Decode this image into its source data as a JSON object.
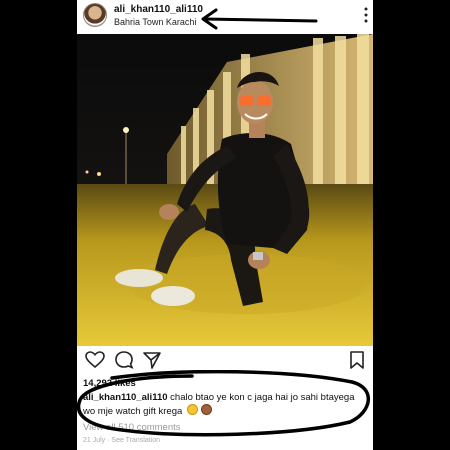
{
  "post": {
    "username": "ali_khan110_ali110",
    "location": "Bahria Town Karachi",
    "likes": "14,292 likes",
    "caption_user": "ali_khan110_ali110",
    "caption_text": " chalo btao ye kon c jaga hai jo sahi btayega wo mje watch gift krega",
    "comments_link": "View all 510 comments",
    "date": "21 July · See Translation"
  },
  "icons": {
    "more": "more-vertical-icon",
    "like": "heart-icon",
    "comment": "comment-bubble-icon",
    "share": "send-icon",
    "save": "bookmark-icon"
  },
  "colors": {
    "annotation": "#000000",
    "photo_glow": "#e8c24a"
  }
}
